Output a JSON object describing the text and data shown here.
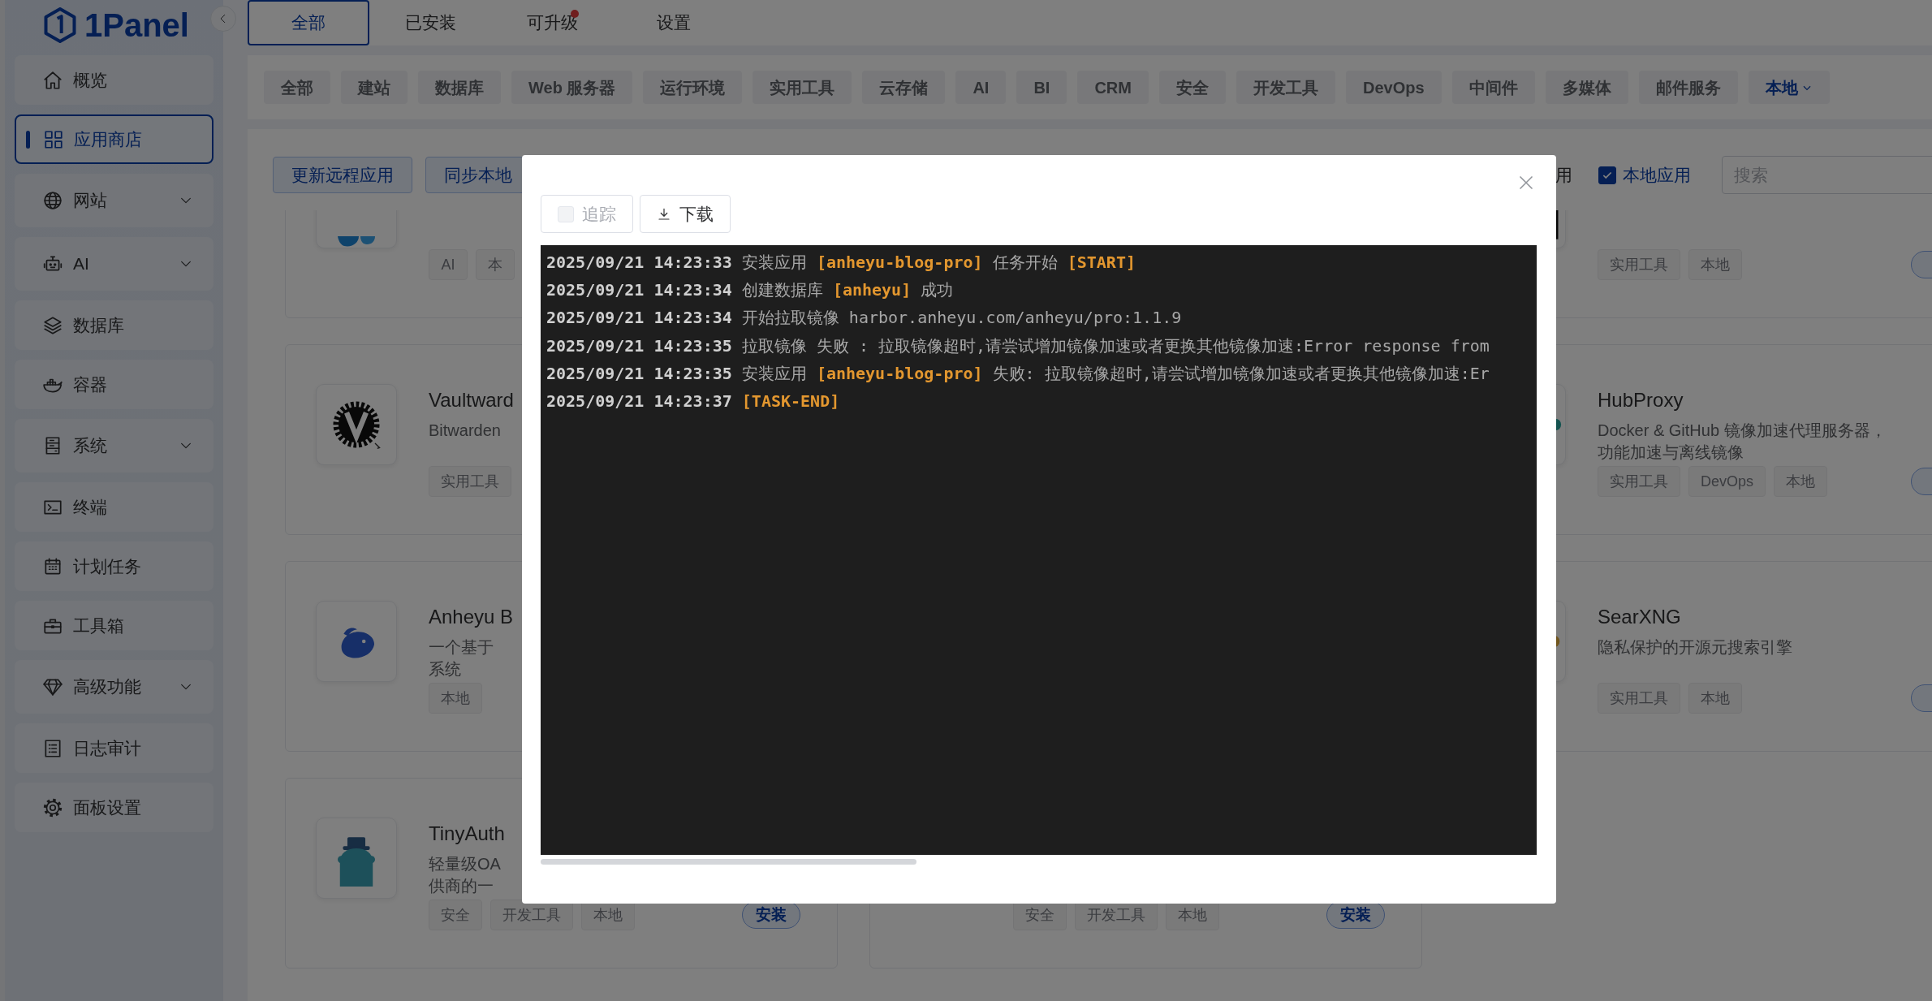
{
  "sidebar": {
    "logo": "1Panel",
    "items": [
      {
        "label": "概览",
        "selected": false,
        "has_submenu": false
      },
      {
        "label": "应用商店",
        "selected": true,
        "has_submenu": false
      },
      {
        "label": "网站",
        "selected": false,
        "has_submenu": true
      },
      {
        "label": "AI",
        "selected": false,
        "has_submenu": true
      },
      {
        "label": "数据库",
        "selected": false,
        "has_submenu": false
      },
      {
        "label": "容器",
        "selected": false,
        "has_submenu": false
      },
      {
        "label": "系统",
        "selected": false,
        "has_submenu": true
      },
      {
        "label": "终端",
        "selected": false,
        "has_submenu": false
      },
      {
        "label": "计划任务",
        "selected": false,
        "has_submenu": false
      },
      {
        "label": "工具箱",
        "selected": false,
        "has_submenu": false
      },
      {
        "label": "高级功能",
        "selected": false,
        "has_submenu": true
      },
      {
        "label": "日志审计",
        "selected": false,
        "has_submenu": false
      },
      {
        "label": "面板设置",
        "selected": false,
        "has_submenu": false
      }
    ]
  },
  "top_tabs": [
    {
      "label": "全部",
      "selected": true,
      "badge_dot": false
    },
    {
      "label": "已安装",
      "selected": false,
      "badge_dot": false
    },
    {
      "label": "可升级",
      "selected": false,
      "badge_dot": true
    },
    {
      "label": "设置",
      "selected": false,
      "badge_dot": false
    }
  ],
  "categories": [
    {
      "label": "全部",
      "selected": false,
      "dropdown": false
    },
    {
      "label": "建站",
      "selected": false,
      "dropdown": false
    },
    {
      "label": "数据库",
      "selected": false,
      "dropdown": false
    },
    {
      "label": "Web 服务器",
      "selected": false,
      "dropdown": false
    },
    {
      "label": "运行环境",
      "selected": false,
      "dropdown": false
    },
    {
      "label": "实用工具",
      "selected": false,
      "dropdown": false
    },
    {
      "label": "云存储",
      "selected": false,
      "dropdown": false
    },
    {
      "label": "AI",
      "selected": false,
      "dropdown": false
    },
    {
      "label": "BI",
      "selected": false,
      "dropdown": false
    },
    {
      "label": "CRM",
      "selected": false,
      "dropdown": false
    },
    {
      "label": "安全",
      "selected": false,
      "dropdown": false
    },
    {
      "label": "开发工具",
      "selected": false,
      "dropdown": false
    },
    {
      "label": "DevOps",
      "selected": false,
      "dropdown": false
    },
    {
      "label": "中间件",
      "selected": false,
      "dropdown": false
    },
    {
      "label": "多媒体",
      "selected": false,
      "dropdown": false
    },
    {
      "label": "邮件服务",
      "selected": false,
      "dropdown": false
    },
    {
      "label": "本地",
      "selected": true,
      "dropdown": true
    }
  ],
  "toolbar": {
    "buttons": [
      "更新远程应用",
      "同步本地"
    ],
    "partial_label": "用",
    "local_apps": {
      "label": "本地应用",
      "checked": true
    },
    "search": {
      "placeholder": "搜索"
    }
  },
  "app_rows": [
    [
      {
        "icon_tile": true,
        "tags": [
          "AI",
          "本"
        ]
      },
      null,
      {
        "icon_tile": true,
        "tags": [
          "实用工具",
          "本地"
        ],
        "install": true
      }
    ],
    [
      {
        "icon_tile": true,
        "title": "Vaultward",
        "description_lines": [
          "Bitwarden"
        ],
        "tags": [
          "实用工具"
        ]
      },
      null,
      {
        "icon_tile": true,
        "title": "HubProxy",
        "description_lines": [
          "Docker & GitHub 镜像加速代理服务器，",
          "功能加速与离线镜像"
        ],
        "tags": [
          "实用工具",
          "DevOps",
          "本地"
        ],
        "install": true
      }
    ],
    [
      {
        "icon_tile": true,
        "title": "Anheyu B",
        "description_lines": [
          "一个基于",
          "系统"
        ],
        "tags": [
          "本地"
        ]
      },
      null,
      {
        "icon_tile": true,
        "title": "SearXNG",
        "description_lines": [
          "隐私保护的开源元搜索引擎"
        ],
        "tags": [
          "实用工具",
          "本地"
        ],
        "install": true
      }
    ],
    [
      {
        "icon_tile": true,
        "title": "TinyAuth",
        "description_lines": [
          "轻量级OA",
          "供商的一"
        ],
        "tags": [
          "安全",
          "开发工具",
          "本地"
        ],
        "install": true,
        "install_label": "安装"
      },
      {
        "tags": [
          "安全",
          "开发工具",
          "本地"
        ],
        "install": true,
        "install_label": "安装"
      },
      null
    ]
  ],
  "dialog": {
    "buttons": [
      {
        "kind": "checkbox",
        "label": "追踪",
        "checked": false,
        "disabled": true
      },
      {
        "kind": "download",
        "label": "下载",
        "disabled": false
      }
    ],
    "log": [
      {
        "time": "2025/09/21 14:23:33",
        "segments": [
          {
            "kind": "plain",
            "text": "安装应用 "
          },
          {
            "kind": "highlight",
            "text": "[anheyu-blog-pro]"
          },
          {
            "kind": "plain",
            "text": " 任务开始 "
          },
          {
            "kind": "highlight",
            "text": "[START]"
          }
        ]
      },
      {
        "time": "2025/09/21 14:23:34",
        "segments": [
          {
            "kind": "plain",
            "text": "创建数据库 "
          },
          {
            "kind": "highlight",
            "text": "[anheyu]"
          },
          {
            "kind": "plain",
            "text": " 成功"
          }
        ]
      },
      {
        "time": "2025/09/21 14:23:34",
        "segments": [
          {
            "kind": "plain",
            "text": "开始拉取镜像 harbor.anheyu.com/anheyu/pro:1.1.9"
          }
        ]
      },
      {
        "time": "2025/09/21 14:23:35",
        "segments": [
          {
            "kind": "plain",
            "text": "拉取镜像 失败 : 拉取镜像超时,请尝试增加镜像加速或者更换其他镜像加速:Error response from"
          }
        ]
      },
      {
        "time": "2025/09/21 14:23:35",
        "segments": [
          {
            "kind": "plain",
            "text": "安装应用 "
          },
          {
            "kind": "highlight",
            "text": "[anheyu-blog-pro]"
          },
          {
            "kind": "plain",
            "text": " 失败: 拉取镜像超时,请尝试增加镜像加速或者更换其他镜像加速:Er"
          }
        ]
      },
      {
        "time": "2025/09/21 14:23:37",
        "segments": [
          {
            "kind": "highlight",
            "text": "[TASK-END]"
          }
        ]
      }
    ]
  }
}
